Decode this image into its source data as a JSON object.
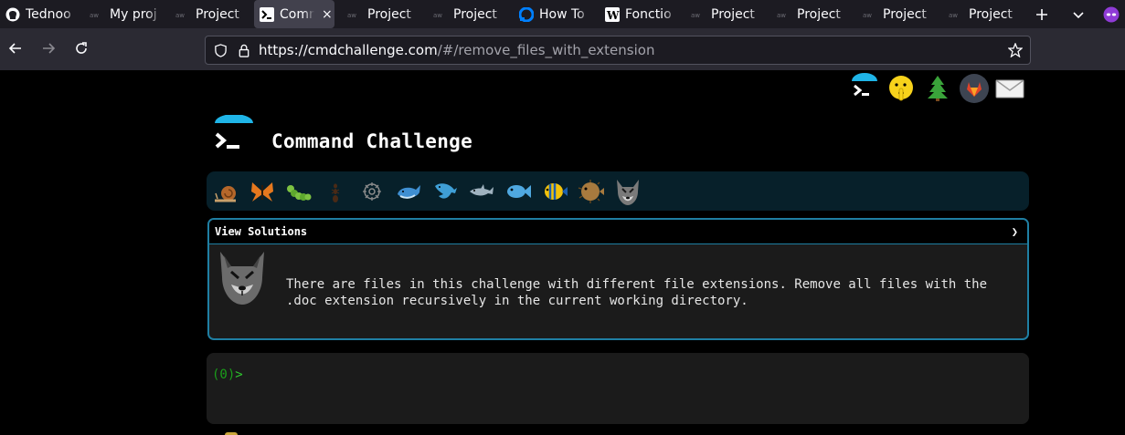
{
  "browser": {
    "tabs": [
      {
        "title": "Tednoo",
        "icon": "github-icon",
        "active": false
      },
      {
        "title": "My proj",
        "icon": "generic-page-icon",
        "active": false
      },
      {
        "title": "Project",
        "icon": "generic-page-icon",
        "active": false
      },
      {
        "title": "Comm",
        "icon": "terminal-icon",
        "active": true
      },
      {
        "title": "Project",
        "icon": "generic-page-icon",
        "active": false
      },
      {
        "title": "Project",
        "icon": "generic-page-icon",
        "active": false
      },
      {
        "title": "How To",
        "icon": "digitalocean-icon",
        "active": false
      },
      {
        "title": "Fonctio",
        "icon": "wikipedia-icon",
        "active": false
      },
      {
        "title": "Project",
        "icon": "generic-page-icon",
        "active": false
      },
      {
        "title": "Project",
        "icon": "generic-page-icon",
        "active": false
      },
      {
        "title": "Project",
        "icon": "generic-page-icon",
        "active": false
      },
      {
        "title": "Project",
        "icon": "generic-page-icon",
        "active": false
      }
    ],
    "close_glyph": "×",
    "url_host": "https://cmdchallenge.com",
    "url_path": "/#/remove_files_with_extension"
  },
  "page": {
    "title": "Command Challenge",
    "panel": {
      "header": "View Solutions",
      "toggle": "❯",
      "description": "There are files in this challenge with different file extensions. Remove all files with the .doc extension recursively in the current working directory."
    },
    "terminal": {
      "prompt_code": "(0)",
      "prompt_arrow": ">"
    },
    "levels": [
      "snail-icon",
      "butterfly-icon",
      "caterpillar-icon",
      "ant-icon",
      "gear-icon",
      "whale-icon",
      "dolphin-icon",
      "dolphin-grey-icon",
      "fish-icon",
      "tropical-fish-icon",
      "blowfish-icon",
      "wolf-icon"
    ],
    "top_icons": [
      "cmdchallenge-logo-icon",
      "shushing-face-icon",
      "tree-icon",
      "gitlab-icon",
      "envelope-icon"
    ]
  },
  "colors": {
    "accent": "#1fb5e8",
    "panel_border": "#1f7fa3",
    "prompt_green": "#2ec62e"
  }
}
